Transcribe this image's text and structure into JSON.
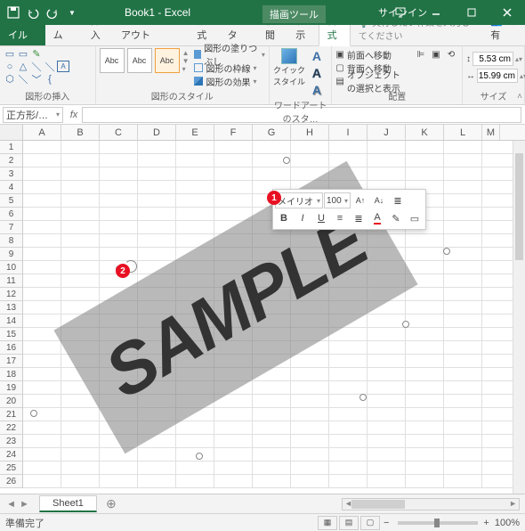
{
  "title": "Book1 - Excel",
  "tool_tab": "描画ツール",
  "signin": "サインイン",
  "tabs": {
    "file": "ファイル",
    "home": "ホーム",
    "insert": "挿入",
    "pagelayout": "ページ レイアウト",
    "formulas": "数式",
    "data": "データ",
    "review": "校閲",
    "view": "表示",
    "format": "書式",
    "tell": "実行したい作業を入力してください",
    "share": "共有"
  },
  "ribbon": {
    "insert_shapes": "図形の挿入",
    "shape_styles": "図形のスタイル",
    "fill": "図形の塗りつぶし",
    "outline": "図形の枠線",
    "effects": "図形の効果",
    "wordart": "ワードアートのスタ…",
    "quick_styles": "クイック\nスタイル",
    "arrange": "配置",
    "bring_forward": "前面へ移動",
    "send_backward": "背面へ移動",
    "selection_pane": "オブジェクトの選択と表示",
    "size": "サイズ",
    "height": "5.53 cm",
    "width": "15.99 cm",
    "abc": "Abc"
  },
  "namebox": "正方形/…",
  "columns": [
    "A",
    "B",
    "C",
    "D",
    "E",
    "F",
    "G",
    "H",
    "I",
    "J",
    "K",
    "L",
    "M"
  ],
  "rows": [
    "1",
    "2",
    "3",
    "4",
    "5",
    "6",
    "7",
    "8",
    "9",
    "10",
    "11",
    "12",
    "13",
    "14",
    "15",
    "16",
    "17",
    "18",
    "19",
    "20",
    "21",
    "22",
    "23",
    "24",
    "25",
    "26"
  ],
  "shape_text": "SAMPLE",
  "mini": {
    "font": "メイリオ",
    "size": "100",
    "bold": "B",
    "italic": "I",
    "underline": "U"
  },
  "badges": {
    "one": "1",
    "two": "2"
  },
  "sheet": "Sheet1",
  "status": "準備完了",
  "zoom": "100%"
}
